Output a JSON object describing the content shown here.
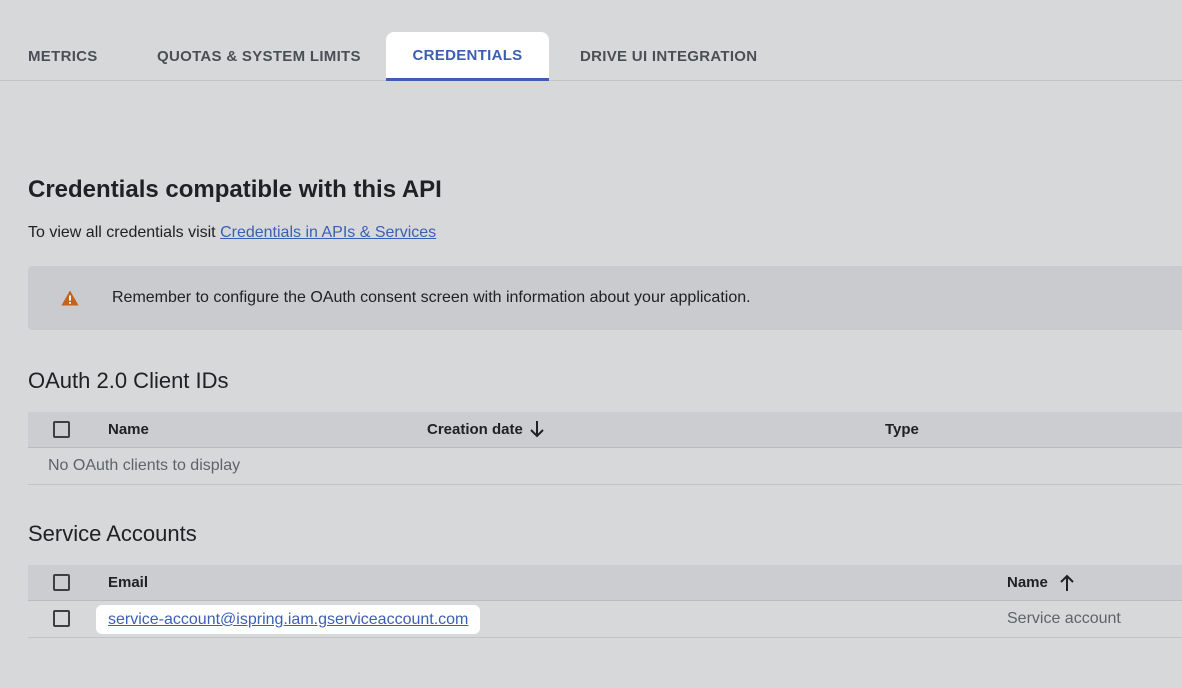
{
  "tabs": [
    {
      "label": "METRICS",
      "active": false
    },
    {
      "label": "QUOTAS & SYSTEM LIMITS",
      "active": false
    },
    {
      "label": "CREDENTIALS",
      "active": true
    },
    {
      "label": "DRIVE UI INTEGRATION",
      "active": false
    }
  ],
  "page": {
    "title": "Credentials compatible with this API",
    "subline_prefix": "To view all credentials visit ",
    "subline_link": "Credentials in APIs & Services"
  },
  "banner": {
    "icon": "warning-icon",
    "message": "Remember to configure the OAuth consent screen with information about your application."
  },
  "oauth": {
    "title": "OAuth 2.0 Client IDs",
    "columns": {
      "name": "Name",
      "creation_date": "Creation date",
      "type": "Type"
    },
    "empty_text": "No OAuth clients to display"
  },
  "service_accounts": {
    "title": "Service Accounts",
    "columns": {
      "email": "Email",
      "name": "Name"
    },
    "rows": [
      {
        "email": "service-account@ispring.iam.gserviceaccount.com",
        "name": "Service account"
      }
    ]
  },
  "colors": {
    "accent": "#3c5fb4",
    "warning": "#c5621c",
    "background": "#d7d8da"
  }
}
